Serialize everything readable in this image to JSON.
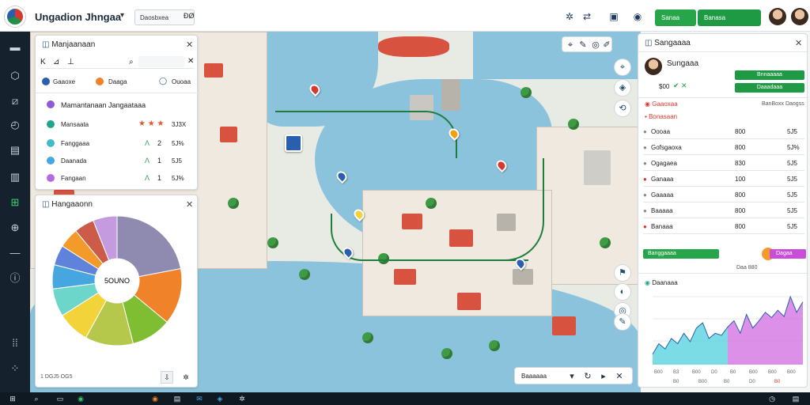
{
  "header": {
    "title": "Ungadion Jhngaa",
    "select_label": "Daosbxea",
    "select_value": "ĐØ",
    "tabs_btn_1": "Sanaa",
    "tabs_btn_2": "Banasa"
  },
  "left_top_panel": {
    "title": "Manjaanaan",
    "search_placeholder": "",
    "filters": [
      "Gaaoxe",
      "Daaga",
      "Ouoaa"
    ],
    "heading": "Mamantanaan Jangaataaa",
    "rows": [
      {
        "label": "Mansaata",
        "value": "3J3X"
      },
      {
        "label": "Fanggaaa",
        "mid": "2",
        "value": "5J%"
      },
      {
        "label": "Daanada",
        "mid": "1",
        "value": "5J5"
      },
      {
        "label": "Fangaan",
        "mid": "1",
        "value": "5J%"
      }
    ]
  },
  "left_bottom_panel": {
    "title": "Hangaaonn",
    "center_label": "5OUNO",
    "footer": "1 DGJ5 OG5",
    "chart_data": {
      "type": "pie",
      "values": [
        22,
        14,
        10,
        12,
        8,
        7,
        6,
        5,
        5,
        5,
        6
      ],
      "colors": [
        "#8f8bb0",
        "#f0822a",
        "#7fbd33",
        "#b6c84b",
        "#f2d43a",
        "#6bd6c9",
        "#45a6e0",
        "#5f83db",
        "#f39a2b",
        "#cc5b47",
        "#c59be0"
      ]
    }
  },
  "right_panel": {
    "title": "Sangaaaa",
    "profile_name": "Sungaaa",
    "profile_stats": "$00",
    "btn_1": "Bnnaaaaa",
    "btn_2": "Daaadaaa",
    "section_1": "Gaaoxaa",
    "section_1_right": "BanBoxx Daogss",
    "section_2": "Bonasaan",
    "rows": [
      {
        "label": "Oooaa",
        "mid": "800",
        "value": "5J5"
      },
      {
        "label": "Gofsgaoxa",
        "mid": "800",
        "value": "5J%"
      },
      {
        "label": "Ogagaea",
        "mid": "830",
        "value": "5J5"
      },
      {
        "label": "Ganaaa",
        "mid": "100",
        "value": "5J5"
      },
      {
        "label": "Gaaaaa",
        "mid": "800",
        "value": "5J5"
      },
      {
        "label": "Baaaaa",
        "mid": "800",
        "value": "5J5"
      },
      {
        "label": "Banaaa",
        "mid": "800",
        "value": "5J5"
      }
    ],
    "green_bar_label": "Banggaaaa",
    "orange_bar_label": "Dagaa Nasa",
    "orange_bar_sub": "Daa 880",
    "chart_title": "Daanaaa",
    "x_labels": [
      "B00",
      "B3",
      "B00",
      "D0",
      "B0",
      "B00",
      "B00",
      "B00"
    ],
    "footer_vals": [
      "B0",
      "B00",
      "B0",
      "D0",
      "B0"
    ],
    "chart_data": {
      "type": "area",
      "series": [
        {
          "values": [
            1,
            2,
            1.5,
            2.5,
            2,
            3,
            2.2,
            3.5,
            4,
            2.5,
            3,
            2.8,
            3.6,
            4.2,
            3,
            4.8,
            3.5,
            4.2,
            5,
            4.5,
            5.2,
            4.6,
            6.5,
            5,
            6
          ]
        }
      ]
    }
  },
  "map_bottom": {
    "zoom": "Baaaaaa"
  }
}
